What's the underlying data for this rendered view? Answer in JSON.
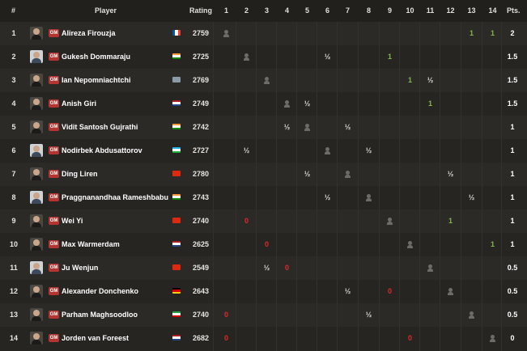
{
  "headers": {
    "num": "#",
    "player": "Player",
    "rating": "Rating",
    "rounds": [
      "1",
      "2",
      "3",
      "4",
      "5",
      "6",
      "7",
      "8",
      "9",
      "10",
      "11",
      "12",
      "13",
      "14"
    ],
    "pts": "Pts."
  },
  "players": [
    {
      "num": "1",
      "title": "GM",
      "name": "Alireza Firouzja",
      "rating": "2759",
      "flag": "fr",
      "avatar": "dark",
      "results": [
        "self",
        "",
        "",
        "",
        "",
        "",
        "",
        "",
        "",
        "",
        "",
        "",
        "1",
        "1"
      ],
      "pts": "2"
    },
    {
      "num": "2",
      "title": "GM",
      "name": "Gukesh Dommaraju",
      "rating": "2725",
      "flag": "in",
      "avatar": "light",
      "results": [
        "",
        "self",
        "",
        "",
        "",
        "½",
        "",
        "",
        "1",
        "",
        "",
        "",
        "",
        ""
      ],
      "pts": "1.5"
    },
    {
      "num": "3",
      "title": "GM",
      "name": "Ian Nepomniachtchi",
      "rating": "2769",
      "flag": "fide",
      "avatar": "dark",
      "results": [
        "",
        "",
        "self",
        "",
        "",
        "",
        "",
        "",
        "",
        "1",
        "½",
        "",
        "",
        ""
      ],
      "pts": "1.5"
    },
    {
      "num": "4",
      "title": "GM",
      "name": "Anish Giri",
      "rating": "2749",
      "flag": "nl",
      "avatar": "dark",
      "results": [
        "",
        "",
        "",
        "self",
        "½",
        "",
        "",
        "",
        "",
        "",
        "1",
        "",
        "",
        ""
      ],
      "pts": "1.5"
    },
    {
      "num": "5",
      "title": "GM",
      "name": "Vidit Santosh Gujrathi",
      "rating": "2742",
      "flag": "in",
      "avatar": "dark",
      "results": [
        "",
        "",
        "",
        "½",
        "self",
        "",
        "½",
        "",
        "",
        "",
        "",
        "",
        "",
        ""
      ],
      "pts": "1"
    },
    {
      "num": "6",
      "title": "GM",
      "name": "Nodirbek Abdusattorov",
      "rating": "2727",
      "flag": "uz",
      "avatar": "light",
      "results": [
        "",
        "½",
        "",
        "",
        "",
        "self",
        "",
        "½",
        "",
        "",
        "",
        "",
        "",
        ""
      ],
      "pts": "1"
    },
    {
      "num": "7",
      "title": "GM",
      "name": "Ding Liren",
      "rating": "2780",
      "flag": "cn",
      "avatar": "dark",
      "results": [
        "",
        "",
        "",
        "",
        "½",
        "",
        "self",
        "",
        "",
        "",
        "",
        "½",
        "",
        ""
      ],
      "pts": "1"
    },
    {
      "num": "8",
      "title": "GM",
      "name": "Praggnanandhaa Rameshbabu",
      "rating": "2743",
      "flag": "in",
      "avatar": "light",
      "results": [
        "",
        "",
        "",
        "",
        "",
        "½",
        "",
        "self",
        "",
        "",
        "",
        "",
        "½",
        ""
      ],
      "pts": "1"
    },
    {
      "num": "9",
      "title": "GM",
      "name": "Wei Yi",
      "rating": "2740",
      "flag": "cn",
      "avatar": "dark",
      "results": [
        "",
        "0",
        "",
        "",
        "",
        "",
        "",
        "",
        "self",
        "",
        "",
        "1",
        "",
        ""
      ],
      "pts": "1"
    },
    {
      "num": "10",
      "title": "GM",
      "name": "Max Warmerdam",
      "rating": "2625",
      "flag": "nl",
      "avatar": "dark",
      "results": [
        "",
        "",
        "0",
        "",
        "",
        "",
        "",
        "",
        "",
        "self",
        "",
        "",
        "",
        "1"
      ],
      "pts": "1"
    },
    {
      "num": "11",
      "title": "GM",
      "name": "Ju Wenjun",
      "rating": "2549",
      "flag": "cn",
      "avatar": "light",
      "results": [
        "",
        "",
        "½",
        "0",
        "",
        "",
        "",
        "",
        "",
        "",
        "self",
        "",
        "",
        ""
      ],
      "pts": "0.5"
    },
    {
      "num": "12",
      "title": "GM",
      "name": "Alexander Donchenko",
      "rating": "2643",
      "flag": "de",
      "avatar": "dark",
      "results": [
        "",
        "",
        "",
        "",
        "",
        "",
        "½",
        "",
        "0",
        "",
        "",
        "self",
        "",
        ""
      ],
      "pts": "0.5"
    },
    {
      "num": "13",
      "title": "GM",
      "name": "Parham Maghsoodloo",
      "rating": "2740",
      "flag": "ir",
      "avatar": "dark",
      "results": [
        "0",
        "",
        "",
        "",
        "",
        "",
        "",
        "½",
        "",
        "",
        "",
        "",
        "self",
        ""
      ],
      "pts": "0.5"
    },
    {
      "num": "14",
      "title": "GM",
      "name": "Jorden van Foreest",
      "rating": "2682",
      "flag": "nl",
      "avatar": "dark",
      "results": [
        "0",
        "",
        "",
        "",
        "",
        "",
        "",
        "",
        "",
        "0",
        "",
        "",
        "",
        "self"
      ],
      "pts": "0"
    }
  ],
  "colors": {
    "win": "#81b64c",
    "loss": "#e02828",
    "draw": "#d9d8d6",
    "gm_badge": "#b33430"
  }
}
